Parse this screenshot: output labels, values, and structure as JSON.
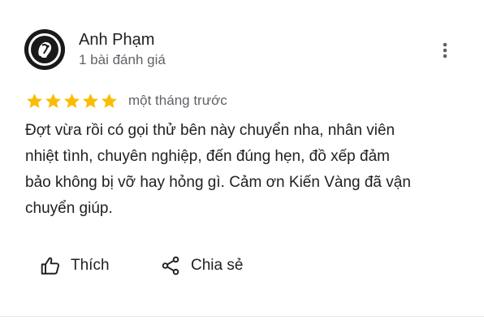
{
  "reviewer": {
    "name": "Anh Phạm",
    "review_count": "1 bài đánh giá"
  },
  "rating": {
    "stars": 5,
    "max_stars": 5,
    "date": "một tháng trước",
    "star_color": "#fbbc04"
  },
  "review": {
    "text": "Đợt vừa rồi có gọi thử bên này chuyển nha, nhân viên\nnhiệt tình, chuyên nghiệp, đến đúng hẹn, đồ xếp đảm\nbảo không bị vỡ hay hỏng gì. Cảm ơn Kiến Vàng đã vận\nchuyển giúp."
  },
  "actions": {
    "like_label": "Thích",
    "share_label": "Chia sẻ"
  },
  "icons": {
    "more": "more-vert-icon",
    "like": "thumb-up-icon",
    "share": "share-icon",
    "star": "star-icon"
  }
}
